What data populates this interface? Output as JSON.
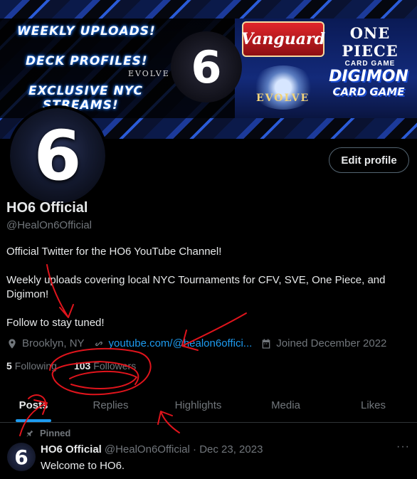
{
  "banner": {
    "tag1": "WEEKLY UPLOADS!",
    "tag2": "DECK PROFILES!",
    "tag3": "EXCLUSIVE NYC",
    "tag4": "STREAMS!",
    "center_number": "6",
    "evolve_small": "EVOLVE",
    "vanguard_logo": "Vanguard",
    "onepiece_line1": "ONE PIECE",
    "onepiece_line2": "CARD GAME",
    "evolve_logo": "EVOLVE",
    "digimon_line1": "DIGIMON",
    "digimon_line2": "CARD GAME"
  },
  "profile": {
    "avatar_text": "6",
    "edit_label": "Edit profile",
    "name": "HO6 Official",
    "handle": "@HealOn6Official",
    "bio": [
      "Official Twitter for the HO6 YouTube Channel!",
      "Weekly uploads covering local NYC Tournaments for CFV, SVE, One Piece, and Digimon!",
      "Follow to stay tuned!"
    ],
    "location": "Brooklyn, NY",
    "link": "youtube.com/@healon6offici...",
    "joined": "Joined December 2022",
    "following_count": "5",
    "following_label": "Following",
    "followers_count": "103",
    "followers_label": "Followers"
  },
  "tabs": [
    "Posts",
    "Replies",
    "Highlights",
    "Media",
    "Likes"
  ],
  "post": {
    "pinned_label": "Pinned",
    "avatar_text": "6",
    "name": "HO6 Official",
    "meta": "@HealOn6Official · Dec 23, 2023",
    "text": "Welcome to HO6.",
    "more": "···"
  },
  "colors": {
    "accent": "#1d9bf0",
    "annotation": "#e0141c",
    "muted": "#71767b"
  }
}
